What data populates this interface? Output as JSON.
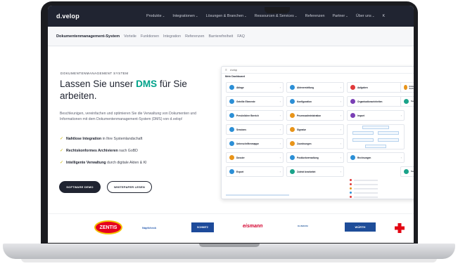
{
  "nav": {
    "logo": "d.velop",
    "items": [
      {
        "label": "Produkte"
      },
      {
        "label": "Integrationen"
      },
      {
        "label": "Lösungen & Branchen"
      },
      {
        "label": "Ressourcen & Services"
      },
      {
        "label": "Referenzen"
      },
      {
        "label": "Partner"
      },
      {
        "label": "Über uns"
      },
      {
        "label": "K"
      }
    ]
  },
  "subnav": {
    "title": "Dokumentenmanagement-System",
    "items": [
      "Vorteile",
      "Funktionen",
      "Integration",
      "Referenzen",
      "Barrierefreiheit",
      "FAQ"
    ]
  },
  "hero": {
    "eyebrow": "DOKUMENTENMANAGEMENT SYSTEM",
    "headline_pre": "Lassen Sie unser ",
    "headline_accent": "DMS",
    "headline_post": " für Sie arbeiten.",
    "description": "Beschleunigen, vereinfachen und optimieren Sie die Verwaltung von Dokumenten und Informationen mit dem Dokumentenmanagement-System (DMS) von d.velop!",
    "features": [
      {
        "bold": "Nahtlose Integration",
        "rest": " in Ihre Systemlandschaft"
      },
      {
        "bold": "Rechtskonformes Archivieren",
        "rest": " nach GoBD"
      },
      {
        "bold": "Intelligente Verwaltung",
        "rest": " durch digitale Akten & KI"
      }
    ],
    "primary_button": "SOFTWARE DEMO",
    "secondary_button": "WHITEPAPER LESEN"
  },
  "mockup": {
    "app_name": "d.velop",
    "title": "Mein Dashboard",
    "tiles": [
      {
        "label": "Ablage",
        "color": "#2c8fd6"
      },
      {
        "label": "Aktenerstellung",
        "color": "#2c8fd6"
      },
      {
        "label": "Aufgaben",
        "color": "#e03a3a"
      },
      {
        "label": "Einfache Suche",
        "color": "#e8941a"
      },
      {
        "label": "Geteilte Elemente",
        "color": "#2c8fd6"
      },
      {
        "label": "Konfiguration",
        "color": "#2c8fd6"
      },
      {
        "label": "Organisationseinheiten",
        "color": "#7a3fb5"
      },
      {
        "label": "Suche",
        "color": "#1aa38a"
      },
      {
        "label": "Persönlicher Bereich",
        "color": "#2c8fd6"
      },
      {
        "label": "Prozessadministration",
        "color": "#e8941a"
      },
      {
        "label": "Import",
        "color": "#7a3fb5"
      },
      {
        "label": "Sessions",
        "color": "#2c8fd6"
      },
      {
        "label": "Signatur",
        "color": "#e8941a"
      },
      {
        "label": "Unterschriftenmappe",
        "color": "#2c8fd6"
      },
      {
        "label": "Zuordnungen",
        "color": "#e8941a"
      },
      {
        "label": "Dossier",
        "color": "#e8941a"
      },
      {
        "label": "Postkorbverwaltung",
        "color": "#2c8fd6"
      },
      {
        "label": "Export",
        "color": "#2c8fd6"
      },
      {
        "label": "Zuletzt bearbeitet",
        "color": "#1aa38a"
      },
      {
        "label": "Rechnungen",
        "color": "#2c8fd6"
      },
      {
        "label": "Suche",
        "color": "#1aa38a"
      }
    ]
  },
  "logos": [
    {
      "name": "ZENTIS"
    },
    {
      "name": "Napfcheck"
    },
    {
      "name": "SCHMITZ"
    },
    {
      "name": "eismann"
    },
    {
      "name": "KLINIKUM"
    },
    {
      "name": "WÜRTH"
    },
    {
      "name": "Deutsches Rotes Kreuz"
    }
  ]
}
